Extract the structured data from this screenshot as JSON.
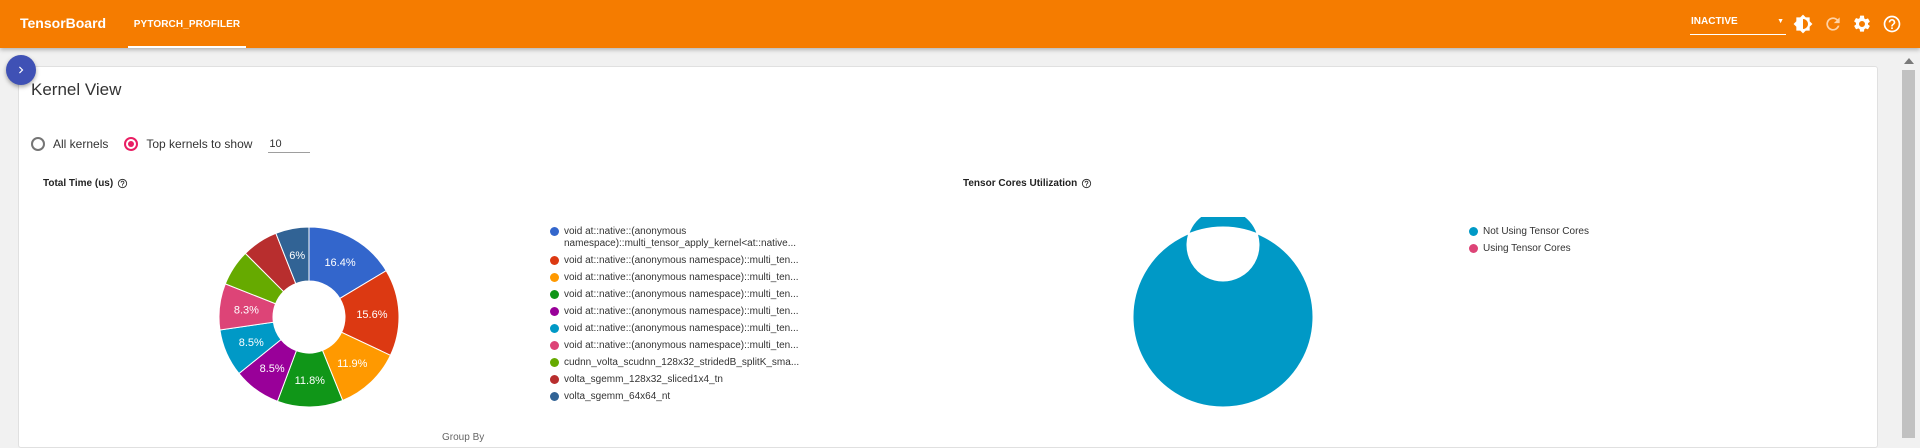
{
  "app": {
    "title": "TensorBoard",
    "active_tab": "PYTORCH_PROFILER",
    "run_status": "INACTIVE",
    "accent_color": "#f57c00",
    "icons": [
      "brightness-icon",
      "refresh-icon",
      "settings-icon",
      "help-icon"
    ]
  },
  "page": {
    "title": "Kernel View",
    "radio_all_label": "All kernels",
    "radio_topk_label": "Top kernels to show",
    "topk_value": "10",
    "selected_option": "Top kernels to show",
    "bottom_clipped_text": "Group By"
  },
  "total_time_chart": {
    "title": "Total Time (us)",
    "legend": [
      {
        "label": "void at::native::(anonymous namespace)::multi_tensor_apply_kernel<at::native...",
        "color": "#3366cc"
      },
      {
        "label": "void at::native::(anonymous namespace)::multi_ten...",
        "color": "#dc3912"
      },
      {
        "label": "void at::native::(anonymous namespace)::multi_ten...",
        "color": "#ff9900"
      },
      {
        "label": "void at::native::(anonymous namespace)::multi_ten...",
        "color": "#109618"
      },
      {
        "label": "void at::native::(anonymous namespace)::multi_ten...",
        "color": "#990099"
      },
      {
        "label": "void at::native::(anonymous namespace)::multi_ten...",
        "color": "#0099c6"
      },
      {
        "label": "void at::native::(anonymous namespace)::multi_ten...",
        "color": "#dd4477"
      },
      {
        "label": "cudnn_volta_scudnn_128x32_stridedB_splitK_sma...",
        "color": "#66aa00"
      },
      {
        "label": "volta_sgemm_128x32_sliced1x4_tn",
        "color": "#b82e2e"
      },
      {
        "label": "volta_sgemm_64x64_nt",
        "color": "#316395"
      }
    ]
  },
  "tensor_cores_chart": {
    "title": "Tensor Cores Utilization",
    "legend": [
      {
        "label": "Not Using Tensor Cores",
        "color": "#0099c6"
      },
      {
        "label": "Using Tensor Cores",
        "color": "#dd4477"
      }
    ]
  },
  "chart_data": [
    {
      "type": "pie",
      "title": "Total Time (us)",
      "series": [
        {
          "name": "void at::native::(anonymous namespace)::multi_tensor_apply_kernel<at::native...",
          "value": 16.4,
          "label": "16.4%"
        },
        {
          "name": "void at::native::(anonymous namespace)::multi_ten...",
          "value": 15.6,
          "label": "15.6%"
        },
        {
          "name": "void at::native::(anonymous namespace)::multi_ten...",
          "value": 11.9,
          "label": "11.9%"
        },
        {
          "name": "void at::native::(anonymous namespace)::multi_ten...",
          "value": 11.8,
          "label": "11.8%"
        },
        {
          "name": "void at::native::(anonymous namespace)::multi_ten...",
          "value": 8.5,
          "label": "8.5%"
        },
        {
          "name": "void at::native::(anonymous namespace)::multi_ten...",
          "value": 8.5,
          "label": "8.5%"
        },
        {
          "name": "void at::native::(anonymous namespace)::multi_ten...",
          "value": 8.3,
          "label": "8.3%"
        },
        {
          "name": "cudnn_volta_scudnn_128x32_stridedB_splitK_sma...",
          "value": 6.5,
          "label": ""
        },
        {
          "name": "volta_sgemm_128x32_sliced1x4_tn",
          "value": 6.5,
          "label": ""
        },
        {
          "name": "volta_sgemm_64x64_nt",
          "value": 6.0,
          "label": "6%"
        }
      ],
      "donut": true,
      "legend_position": "right"
    },
    {
      "type": "pie",
      "title": "Tensor Cores Utilization",
      "series": [
        {
          "name": "Not Using Tensor Cores",
          "value": 100,
          "label": ""
        },
        {
          "name": "Using Tensor Cores",
          "value": 0,
          "label": ""
        }
      ],
      "donut": true,
      "legend_position": "right"
    }
  ]
}
